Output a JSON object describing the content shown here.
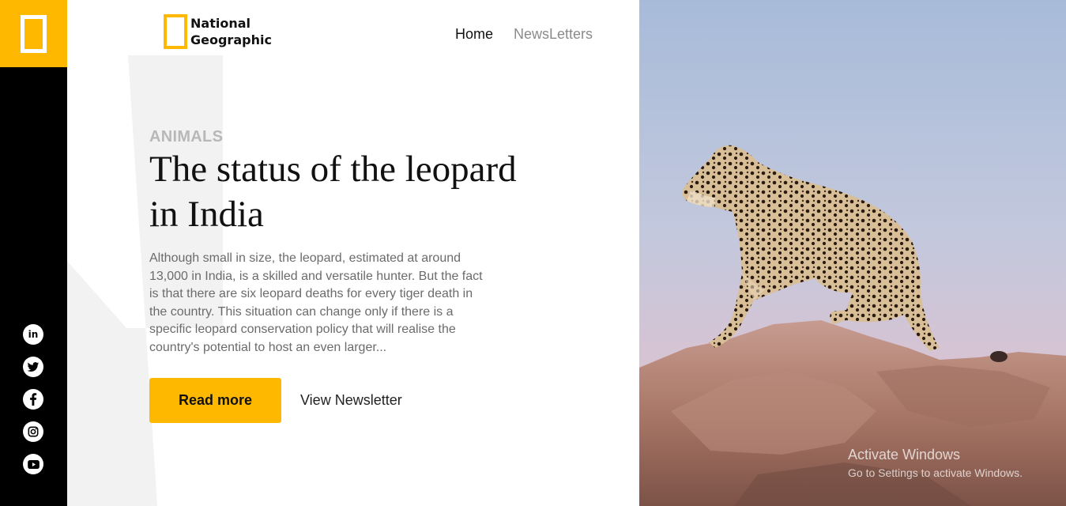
{
  "brand": {
    "line1": "National",
    "line2": "Geographic"
  },
  "nav": {
    "home": "Home",
    "newsletters": "NewsLetters"
  },
  "article": {
    "category": "ANIMALS",
    "title_line1": "The status of the leopard",
    "title_line2": "in India",
    "description": "Although small in size, the leopard, estimated at around 13,000 in India, is a skilled and versatile hunter. But the fact is that there are six leopard deaths for every tiger death in the country. This situation can change only if there is a specific leopard conservation policy that will realise the country's potential to host an even larger..."
  },
  "actions": {
    "read_more": "Read more",
    "view_newsletter": "View Newsletter"
  },
  "social": {
    "icons": [
      "linkedin-icon",
      "twitter-icon",
      "facebook-icon",
      "instagram-icon",
      "youtube-icon"
    ]
  },
  "watermark": {
    "line1": "Activate Windows",
    "line2": "Go to Settings to activate Windows."
  },
  "colors": {
    "accent": "#ffb800",
    "sidebar": "#000000",
    "text_dark": "#111111",
    "text_muted": "#6b6b6b",
    "sky_top": "#a9bcd9",
    "sky_bottom": "#d9c0cf",
    "rock": "#b88779"
  }
}
